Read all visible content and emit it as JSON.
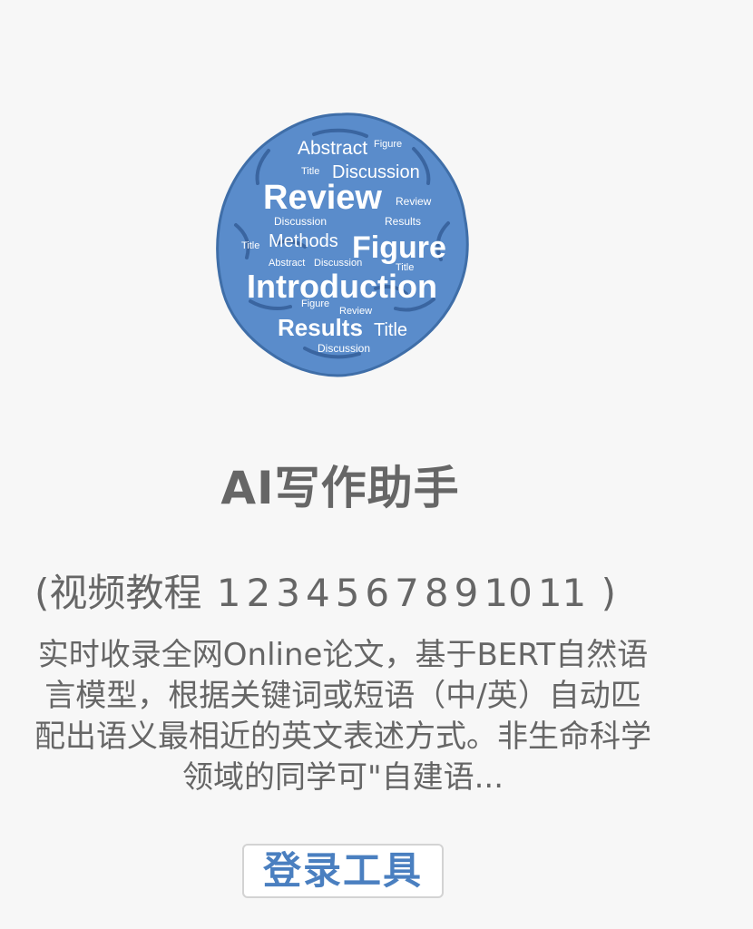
{
  "logo": {
    "background_color": "#5a8ccb",
    "words": {
      "w1": "Abstract",
      "w2": "Figure",
      "w3": "Title",
      "w4": "Discussion",
      "w5": "Review",
      "w6": "Review",
      "w7": "Discussion",
      "w8": "Results",
      "w9": "Title",
      "w10": "Methods",
      "w11": "Figure",
      "w12": "Abstract",
      "w13": "Discussion",
      "w14": "Title",
      "w15": "Introduction",
      "w16": "Figure",
      "w17": "Review",
      "w18": "Results",
      "w19": "Title",
      "w20": "Discussion"
    }
  },
  "app": {
    "title": "AI写作助手"
  },
  "tutorial": {
    "prefix": "(视频教程",
    "links": [
      "1",
      "2",
      "3",
      "4",
      "5",
      "6",
      "7",
      "8",
      "9",
      "10",
      "11"
    ],
    "suffix": ")"
  },
  "description": "实时收录全网Online论文，基于BERT自然语言模型，根据关键词或短语（中/英）自动匹配出语义最相近的英文表述方式。非生命科学领域的同学可\"自建语...",
  "login_button": {
    "label": "登录工具"
  },
  "colors": {
    "text": "#666666",
    "accent": "#4a7fc0",
    "background": "#f7f7f7"
  }
}
